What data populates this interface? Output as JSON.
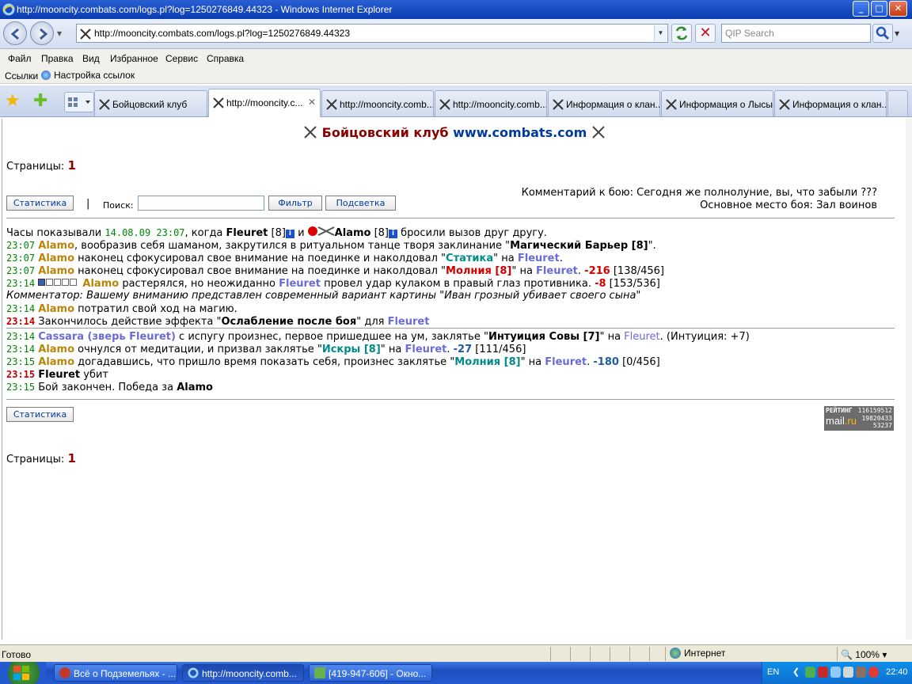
{
  "window": {
    "title": "http://mooncity.combats.com/logs.pl?log=1250276849.44323 - Windows Internet Explorer",
    "buttons": [
      "minimize",
      "maximize",
      "close"
    ]
  },
  "address_bar": {
    "url": "http://mooncity.combats.com/logs.pl?log=1250276849.44323",
    "search_placeholder": "QIP Search"
  },
  "menu": [
    "Файл",
    "Правка",
    "Вид",
    "Избранное",
    "Сервис",
    "Справка"
  ],
  "links_bar": {
    "label": "Ссылки",
    "item": "Настройка ссылок"
  },
  "tabs": [
    {
      "label": "Бойцовский клуб",
      "active": false
    },
    {
      "label": "http://mooncity.c...",
      "active": true
    },
    {
      "label": "http://mooncity.comb...",
      "active": false
    },
    {
      "label": "http://mooncity.comb...",
      "active": false
    },
    {
      "label": "Информация о клан...",
      "active": false
    },
    {
      "label": "Информация о Лысы...",
      "active": false
    },
    {
      "label": "Информация о клан...",
      "active": false
    }
  ],
  "page": {
    "header_title": "Бойцовский клуб",
    "header_site": "www.combats.com",
    "pages_label": "Страницы:",
    "pages_num": "1",
    "stats_button": "Статистика",
    "separator": "|",
    "search_label": "Поиск:",
    "filter_button": "Фильтр",
    "highlight_button": "Подсветка",
    "comment_line1": "Комментарий к бою: Сегодня же полнолуние, вы, что забыли ???",
    "comment_line2": "Основное место боя: Зал воинов",
    "stats_button_bottom": "Статистика",
    "pages_label_bottom": "Страницы:",
    "pages_num_bottom": "1"
  },
  "log": {
    "intro": {
      "t1": "Часы показывали ",
      "date": "14.08.09 23:07",
      "t2": ", когда ",
      "p1": "Fleuret",
      "lvl1": " [8]",
      "t3": " и ",
      "p2": "Alamo",
      "lvl2": " [8]",
      "t4": " бросили вызов друг другу."
    },
    "l1": {
      "time": "23:07",
      "who": "Alamo",
      "t1": ", вообразив себя шаманом, закрутился в ритуальном танце творя заклинание \"",
      "spell": "Магический Барьер [8]",
      "t2": "\"."
    },
    "l2": {
      "time": "23:07",
      "who": "Alamo",
      "t1": " наконец сфокусировал свое внимание на поединке и наколдовал \"",
      "spell": "Статика",
      "t2": "\" на ",
      "target": "Fleuret",
      "t3": "."
    },
    "l3": {
      "time": "23:07",
      "who": "Alamo",
      "t1": " наконец сфокусировал свое внимание на поединке и наколдовал \"",
      "spell": "Молния [8]",
      "t2": "\" на ",
      "target": "Fleuret",
      "t3": ". ",
      "dmg": "-216",
      "hp": " [138/456]"
    },
    "l4": {
      "time": "23:14",
      "who": "Alamo",
      "t1": " растерялся, но неожиданно ",
      "target": "Fleuret",
      "t2": " провел удар кулаком в правый глаз противника. ",
      "dmg": "-8",
      "hp": " [153/536]"
    },
    "l5": {
      "text": "Комментатор: Вашему вниманию представлен современный вариант картины \"Иван грозный убивает своего сына\""
    },
    "l6": {
      "time": "23:14",
      "who": "Alamo",
      "t1": " потратил свой ход на магию."
    },
    "l7": {
      "time": "23:14",
      "t1": "Закончилось действие эффекта \"",
      "effect": "Ослабление после боя",
      "t2": "\" для ",
      "target": "Fleuret"
    },
    "l8": {
      "time": "23:14",
      "who": "Cassara (зверь Fleuret)",
      "t1": " с испугу произнес, первое пришедшее на ум, заклятье \"",
      "spell": "Интуиция Совы [7]",
      "t2": "\" на ",
      "target": "Fleuret",
      "t3": ". (Интуиция: +7)"
    },
    "l9": {
      "time": "23:14",
      "who": "Alamo",
      "t1": " очнулся от медитации, и призвал заклятье \"",
      "spell": "Искры [8]",
      "t2": "\" на ",
      "target": "Fleuret",
      "t3": ". ",
      "dmg": "-27",
      "hp": " [111/456]"
    },
    "l10": {
      "time": "23:15",
      "who": "Alamo",
      "t1": " догадавшись, что пришло время показать себя, произнес заклятье \"",
      "spell": "Молния [8]",
      "t2": "\" на ",
      "target": "Fleuret",
      "t3": ". ",
      "dmg": "-180",
      "hp": " [0/456]"
    },
    "l11": {
      "time": "23:15",
      "who": "Fleuret",
      "t1": " убит"
    },
    "l12": {
      "time": "23:15",
      "t1": "Бой закончен. Победа за ",
      "who": "Alamo"
    }
  },
  "counter": {
    "label": "РЕЙТИНГ",
    "v1": "116159512",
    "brand_a": "mail",
    "brand_b": ".ru",
    "v2": "19820433",
    "v3": "53237"
  },
  "status_bar": {
    "ready": "Готово",
    "zone": "Интернет",
    "zoom": "100%"
  },
  "taskbar": {
    "items": [
      {
        "label": "Всё о Подземельях - ..."
      },
      {
        "label": "http://mooncity.comb..."
      },
      {
        "label": "[419-947-606] - Окно..."
      }
    ],
    "lang": "EN",
    "clock": "22:40"
  },
  "colors": {
    "title_red": "#8b0000",
    "link_blue": "#003a9e",
    "alamo": "#b8860b",
    "fleuret": "#6b6bd6",
    "time_green": "#008800",
    "damage_red": "#d40000"
  }
}
